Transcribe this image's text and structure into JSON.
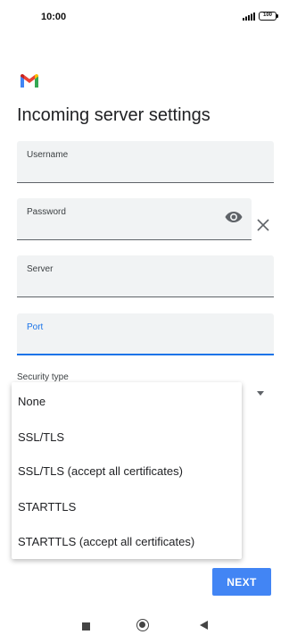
{
  "status_bar": {
    "time": "10:00",
    "battery": "100"
  },
  "brand": {
    "logo_icon": "gmail-logo-icon"
  },
  "page": {
    "title": "Incoming server settings"
  },
  "form": {
    "username_label": "Username",
    "username_value": "",
    "password_label": "Password",
    "password_value": "",
    "server_label": "Server",
    "server_value": "",
    "port_label": "Port",
    "port_value": "",
    "security_type_label": "Security type"
  },
  "dropdown": {
    "options": [
      "None",
      "SSL/TLS",
      "SSL/TLS (accept all certificates)",
      "STARTTLS",
      "STARTTLS (accept all certificates)"
    ]
  },
  "actions": {
    "next_label": "NEXT"
  },
  "colors": {
    "accent": "#1a73e8",
    "button": "#4285f4",
    "field_bg": "#f1f3f4"
  }
}
